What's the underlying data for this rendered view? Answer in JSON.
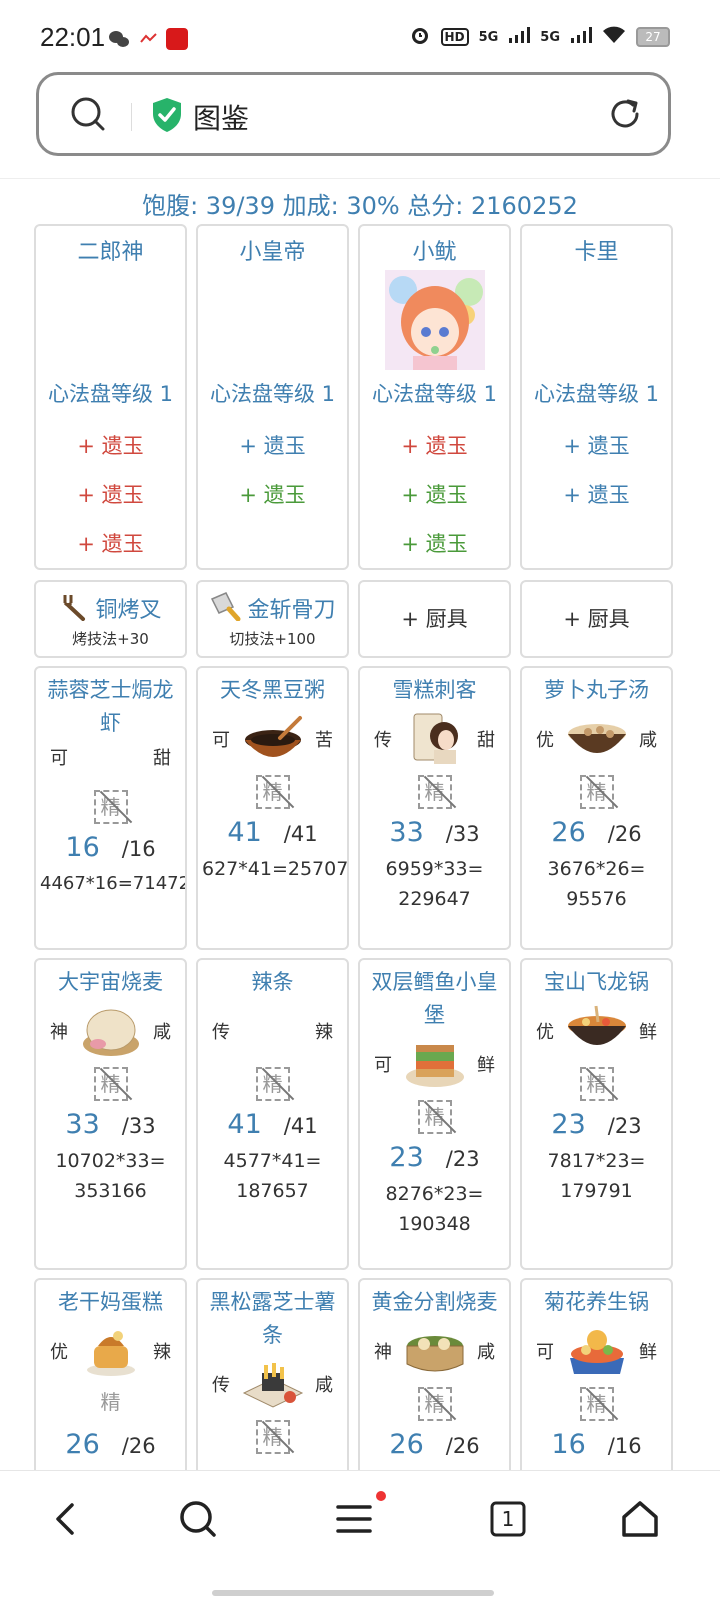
{
  "status_bar": {
    "time": "22:01",
    "hd": "HD",
    "sim1": "5G",
    "sim2": "5G",
    "battery": "27"
  },
  "address_bar": {
    "title": "图鉴"
  },
  "summary": "饱腹: 39/39 加成: 30% 总分: 2160252",
  "colors": {
    "accent": "#3f7fb0",
    "red": "#d0483e",
    "green": "#4a9a3a"
  },
  "chefs": [
    {
      "name": "二郎神",
      "level": "心法盘等级 1",
      "jades": [
        {
          "text": "+ 遗玉"
        },
        {
          "text": "+ 遗玉"
        },
        {
          "text": "+ 遗玉"
        }
      ]
    },
    {
      "name": "小皇帝",
      "level": "心法盘等级 1",
      "jades": [
        {
          "text": "+ 遗玉"
        },
        {
          "text": "+ 遗玉"
        }
      ]
    },
    {
      "name": "小鱿",
      "level": "心法盘等级 1",
      "jades": [
        {
          "text": "+ 遗玉"
        },
        {
          "text": "+ 遗玉"
        },
        {
          "text": "+ 遗玉"
        }
      ]
    },
    {
      "name": "卡里",
      "level": "心法盘等级 1",
      "jades": [
        {
          "text": "+ 遗玉"
        },
        {
          "text": "+ 遗玉"
        }
      ]
    }
  ],
  "tools": [
    {
      "name": "铜烤叉",
      "skill": "烤技法+30"
    },
    {
      "name": "金斩骨刀",
      "skill": "切技法+100"
    },
    {
      "add": "+ 厨具"
    },
    {
      "add": "+ 厨具"
    }
  ],
  "recipes": [
    {
      "name": "蒜蓉芝士焗龙虾",
      "left": "可",
      "right": "甜",
      "refine": "精",
      "qty": "16",
      "total": "/16",
      "score": "4467*16=71472"
    },
    {
      "name": "天冬黑豆粥",
      "left": "可",
      "right": "苦",
      "refine": "精",
      "qty": "41",
      "total": "/41",
      "score": "627*41=25707"
    },
    {
      "name": "雪糕刺客",
      "left": "传",
      "right": "甜",
      "refine": "精",
      "qty": "33",
      "total": "/33",
      "score_line1": "6959*33=",
      "score_line2": "229647"
    },
    {
      "name": "萝卜丸子汤",
      "left": "优",
      "right": "咸",
      "refine": "精",
      "qty": "26",
      "total": "/26",
      "score_line1": "3676*26=",
      "score_line2": "95576"
    },
    {
      "name": "大宇宙烧麦",
      "left": "神",
      "right": "咸",
      "refine": "精",
      "qty": "33",
      "total": "/33",
      "score_line1": "10702*33=",
      "score_line2": "353166"
    },
    {
      "name": "辣条",
      "left": "传",
      "right": "辣",
      "refine": "精",
      "qty": "41",
      "total": "/41",
      "score_line1": "4577*41=",
      "score_line2": "187657"
    },
    {
      "name": "双层鳕鱼小皇堡",
      "left": "可",
      "right": "鲜",
      "refine": "精",
      "qty": "23",
      "total": "/23",
      "score_line1": "8276*23=",
      "score_line2": "190348"
    },
    {
      "name": "宝山飞龙锅",
      "left": "优",
      "right": "鲜",
      "refine": "精",
      "qty": "23",
      "total": "/23",
      "score_line1": "7817*23=",
      "score_line2": "179791"
    },
    {
      "name": "老干妈蛋糕",
      "left": "优",
      "right": "辣",
      "refine": "精",
      "qty": "26",
      "total": "/26"
    },
    {
      "name": "黑松露芝士薯条",
      "left": "传",
      "right": "咸",
      "refine": "精"
    },
    {
      "name": "黄金分割烧麦",
      "left": "神",
      "right": "咸",
      "refine": "精",
      "qty": "26",
      "total": "/26"
    },
    {
      "name": "菊花养生锅",
      "left": "可",
      "right": "鲜",
      "refine": "精",
      "qty": "16",
      "total": "/16"
    }
  ],
  "nav": {
    "tabs_count": "1"
  }
}
